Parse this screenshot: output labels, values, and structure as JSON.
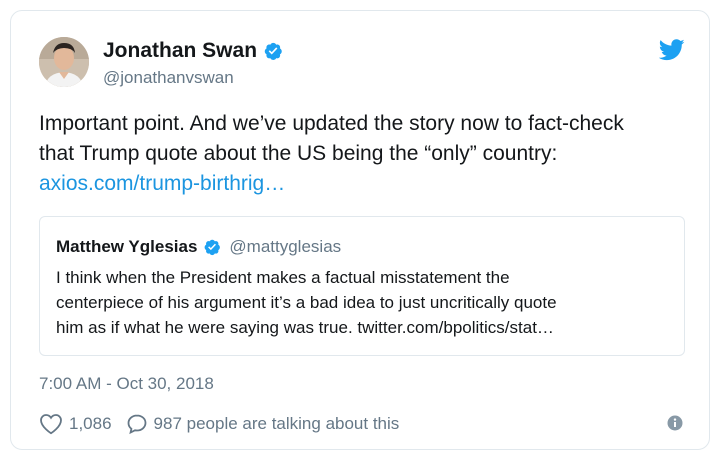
{
  "author": {
    "name": "Jonathan Swan",
    "handle": "@jonathanvswan",
    "verified": true
  },
  "tweet": {
    "lines": [
      "Important point. And we’ve updated the story now to fact-check",
      "that Trump quote about the US being the “only” country:"
    ],
    "link": "axios.com/trump-birthrig…"
  },
  "quoted_tweet": {
    "name": "Matthew Yglesias",
    "handle": "@mattyglesias",
    "verified": true,
    "lines": [
      "I think when the President makes a factual misstatement the",
      "centerpiece of his argument it’s a bad idea to just uncritically quote",
      "him as if what he were saying was true. twitter.com/bpolitics/stat…"
    ]
  },
  "timestamp": "7:00 AM - Oct 30, 2018",
  "actions": {
    "likes": "1,086",
    "replies": "987 people are talking about this"
  },
  "icons": {
    "brand": "twitter-bird-icon",
    "verified": "verified-badge-icon",
    "like": "heart-icon",
    "reply": "speech-bubble-icon",
    "info": "info-icon"
  },
  "colors": {
    "brand_blue": "#1da1f2",
    "link_blue": "#1b95e0",
    "muted_gray": "#657786",
    "border": "#e1e8ed"
  }
}
